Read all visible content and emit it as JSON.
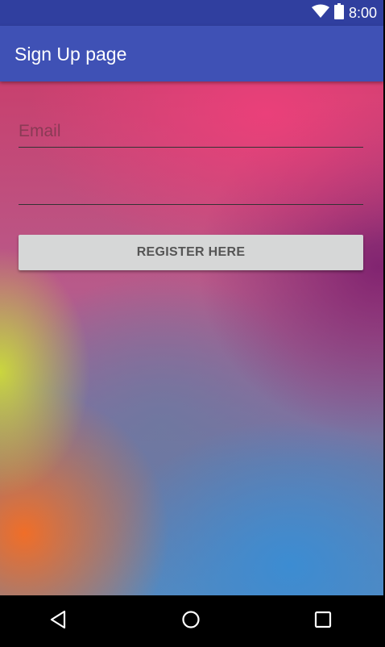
{
  "status_bar": {
    "time": "8:00",
    "icons": [
      "wifi-icon",
      "battery-icon"
    ]
  },
  "app_bar": {
    "title": "Sign Up page"
  },
  "form": {
    "email_placeholder": "Email",
    "email_value": "",
    "password_placeholder": "",
    "password_value": "",
    "register_label": "REGISTER HERE"
  },
  "nav_bar": {
    "buttons": [
      "back-icon",
      "home-icon",
      "recents-icon"
    ]
  },
  "colors": {
    "status_bar": "#303f9f",
    "app_bar": "#3f51b5",
    "button_bg": "#d6d7d7",
    "button_text": "#555555"
  }
}
